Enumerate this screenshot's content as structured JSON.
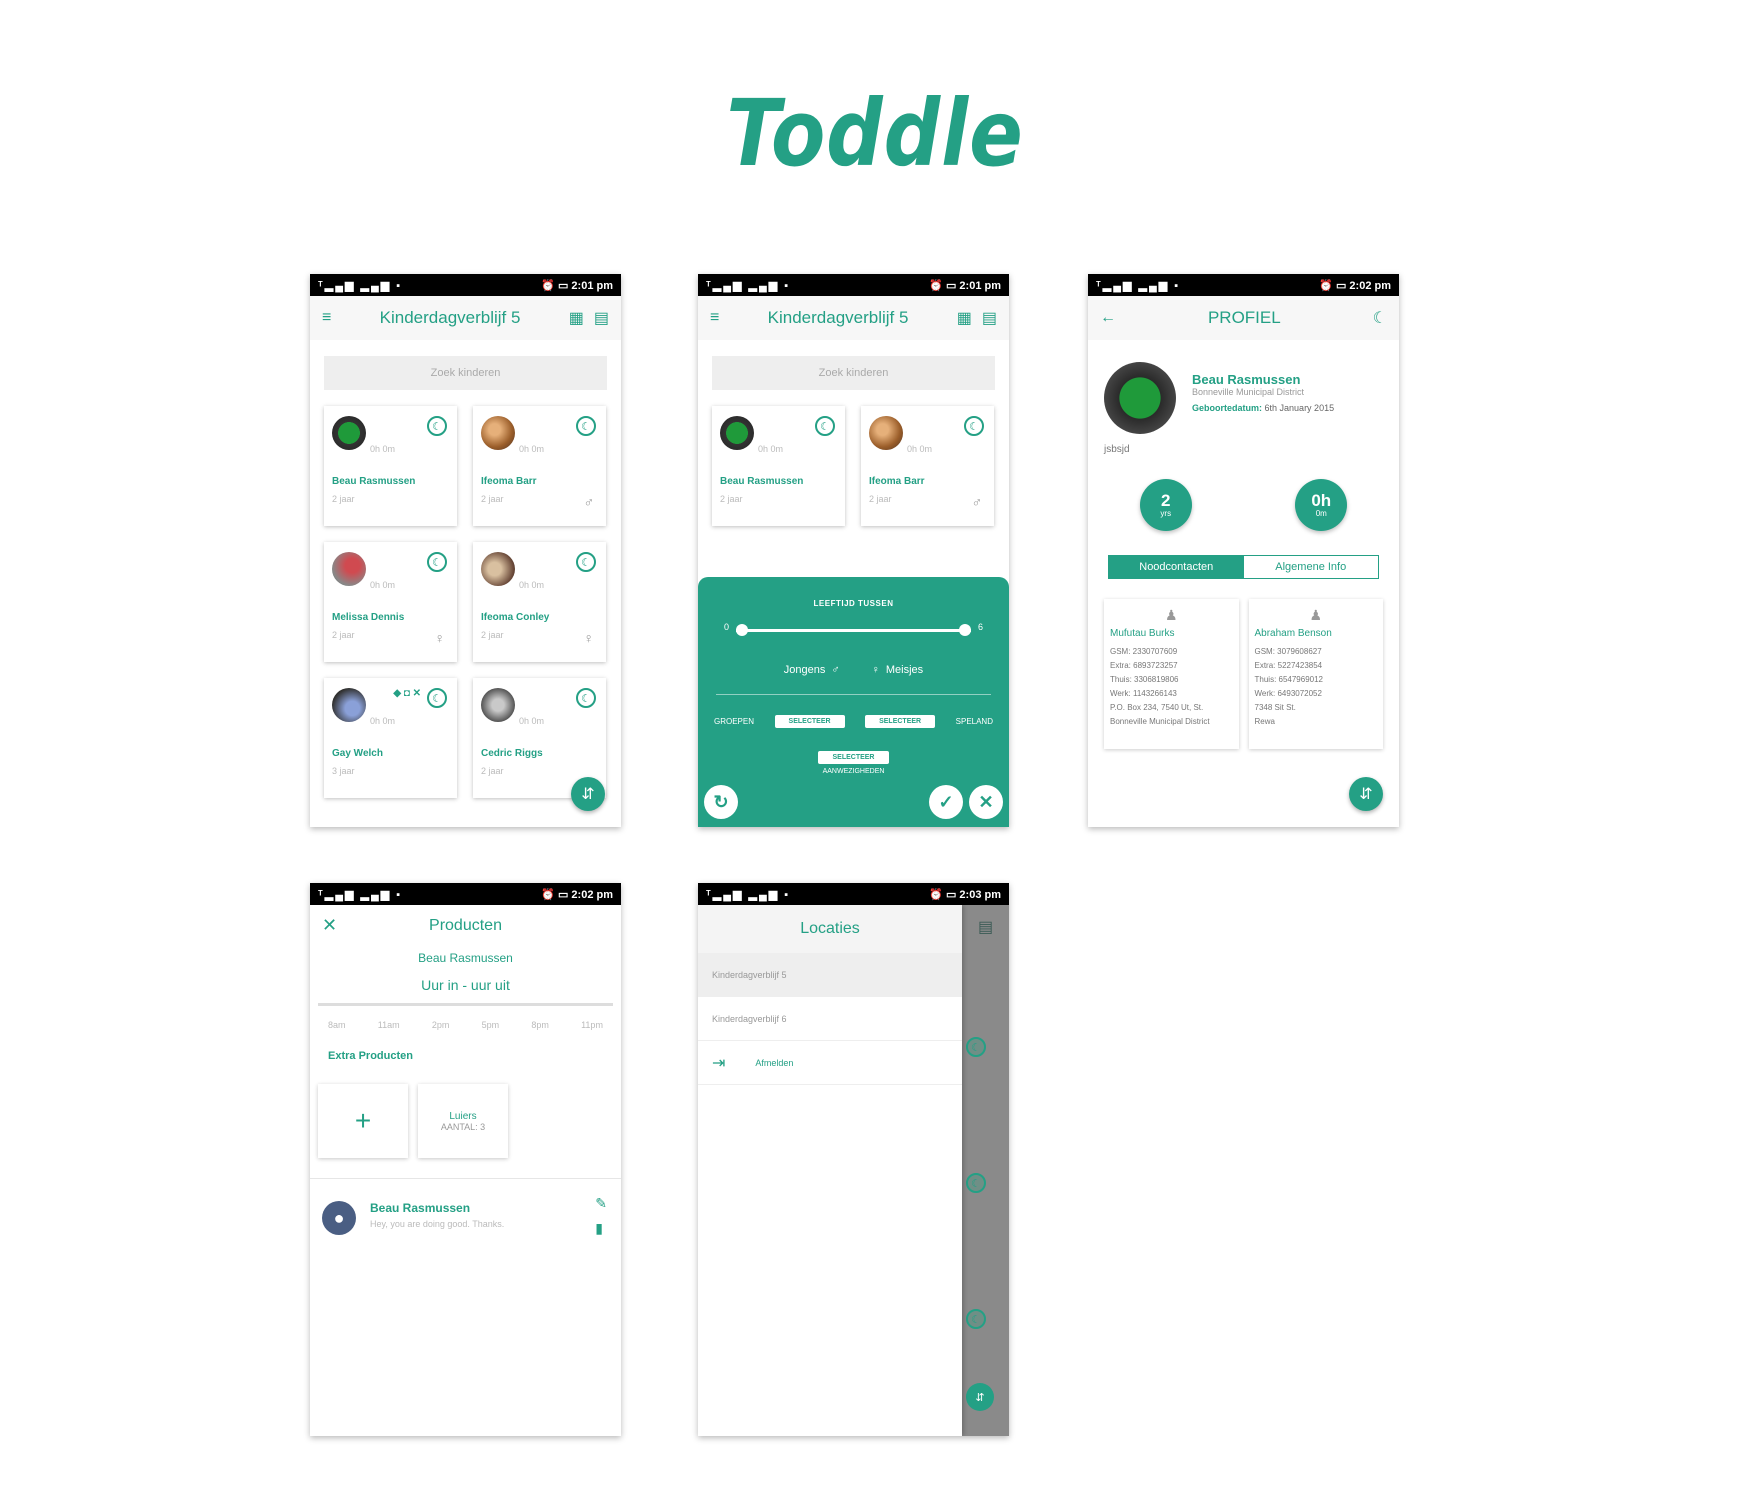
{
  "brand": {
    "title": "Toddle",
    "accent": "#24a085"
  },
  "screens": {
    "s1": {
      "status": {
        "signal": "ᵀ▂▄▆ ▂▄▆ ▪",
        "alarm": "⏰",
        "battery": "▭",
        "time": "2:01 pm"
      },
      "title": "Kinderdagverblijf 5",
      "search_placeholder": "Zoek kinderen",
      "children": [
        {
          "name": "Beau Rasmussen",
          "hours": "0h 0m",
          "age": "2 jaar",
          "gender": ""
        },
        {
          "name": "Ifeoma Barr",
          "hours": "0h 0m",
          "age": "2 jaar",
          "gender": "♂"
        },
        {
          "name": "Melissa Dennis",
          "hours": "0h 0m",
          "age": "2 jaar",
          "gender": "♀"
        },
        {
          "name": "Ifeoma Conley",
          "hours": "0h 0m",
          "age": "2 jaar",
          "gender": "♀"
        },
        {
          "name": "Gay Welch",
          "hours": "0h 0m",
          "age": "3 jaar",
          "gender": "",
          "badges": "◆ ◘ ✕"
        },
        {
          "name": "Cedric Riggs",
          "hours": "0h 0m",
          "age": "2 jaar",
          "gender": ""
        }
      ]
    },
    "s2": {
      "status": {
        "signal": "ᵀ▂▄▆ ▂▄▆ ▪",
        "alarm": "⏰",
        "battery": "▭",
        "time": "2:01 pm"
      },
      "title": "Kinderdagverblijf 5",
      "search_placeholder": "Zoek kinderen",
      "children": [
        {
          "name": "Beau Rasmussen",
          "hours": "0h 0m",
          "age": "2 jaar",
          "gender": ""
        },
        {
          "name": "Ifeoma Barr",
          "hours": "0h 0m",
          "age": "2 jaar",
          "gender": "♂"
        }
      ],
      "filter": {
        "heading": "LEEFTIJD TUSSEN",
        "age_min": "0",
        "age_max": "6",
        "boys": "Jongens",
        "girls": "Meisjes",
        "left_label": "GROEPEN",
        "right_label": "SPELAND",
        "select1": "SELECTEER",
        "select2": "SELECTEER",
        "select3": "SELECTEER",
        "select3_sub": "AANWEZIGHEDEN"
      }
    },
    "s3": {
      "status": {
        "signal": "ᵀ▂▄▆ ▂▄▆ ▪",
        "alarm": "⏰",
        "battery": "▭",
        "time": "2:02 pm"
      },
      "title": "PROFIEL",
      "name": "Beau Rasmussen",
      "district": "Bonneville Municipal District",
      "dob_label": "Geboortedatum:",
      "dob_value": "6th January 2015",
      "note": "jsbsjd",
      "age_value": "2",
      "age_unit": "yrs",
      "time_value": "0h",
      "time_unit": "0m",
      "tab1": "Noodcontacten",
      "tab2": "Algemene Info",
      "contacts": [
        {
          "name": "Mufutau Burks",
          "lines": [
            "GSM: 2330707609",
            "Extra: 6893723257",
            "Thuis: 3306819806",
            "Werk: 1143266143",
            "P.O. Box 234, 7540 Ut, St.",
            "Bonneville Municipal District"
          ]
        },
        {
          "name": "Abraham Benson",
          "lines": [
            "GSM: 3079608627",
            "Extra: 5227423854",
            "Thuis: 6547969012",
            "Werk: 6493072052",
            "7348 Sit St.",
            "Rewa"
          ]
        }
      ]
    },
    "s4": {
      "status": {
        "signal": "ᵀ▂▄▆ ▂▄▆ ▪",
        "alarm": "⏰",
        "battery": "▭",
        "time": "2:02 pm"
      },
      "title": "Producten",
      "child": "Beau Rasmussen",
      "hours": "Uur in  -  uur uit",
      "times": [
        "8am",
        "11am",
        "2pm",
        "5pm",
        "8pm",
        "11pm"
      ],
      "extra": "Extra Producten",
      "product_label": "Luiers",
      "product_qty": "AANTAL: 3",
      "comment_name": "Beau Rasmussen",
      "comment_text": "Hey, you are doing good. Thanks."
    },
    "s5": {
      "status": {
        "signal": "ᵀ▂▄▆ ▂▄▆ ▪",
        "alarm": "⏰",
        "battery": "▭",
        "time": "2:03 pm"
      },
      "title": "Locaties",
      "items": [
        "Kinderdagverblijf 5",
        "Kinderdagverblijf 6"
      ],
      "logout": "Afmelden"
    }
  },
  "icons": {
    "menu": "≡",
    "grid": "▦",
    "list": "▤",
    "moon": "☾",
    "filter": "⇵",
    "back": "←",
    "close": "✕",
    "check": "✓",
    "refresh": "↻",
    "plus": "+",
    "edit": "✎",
    "trash": "▮",
    "person": "♟",
    "logout": "⇥",
    "boy": "♂",
    "girl": "♀",
    "user": "●"
  }
}
